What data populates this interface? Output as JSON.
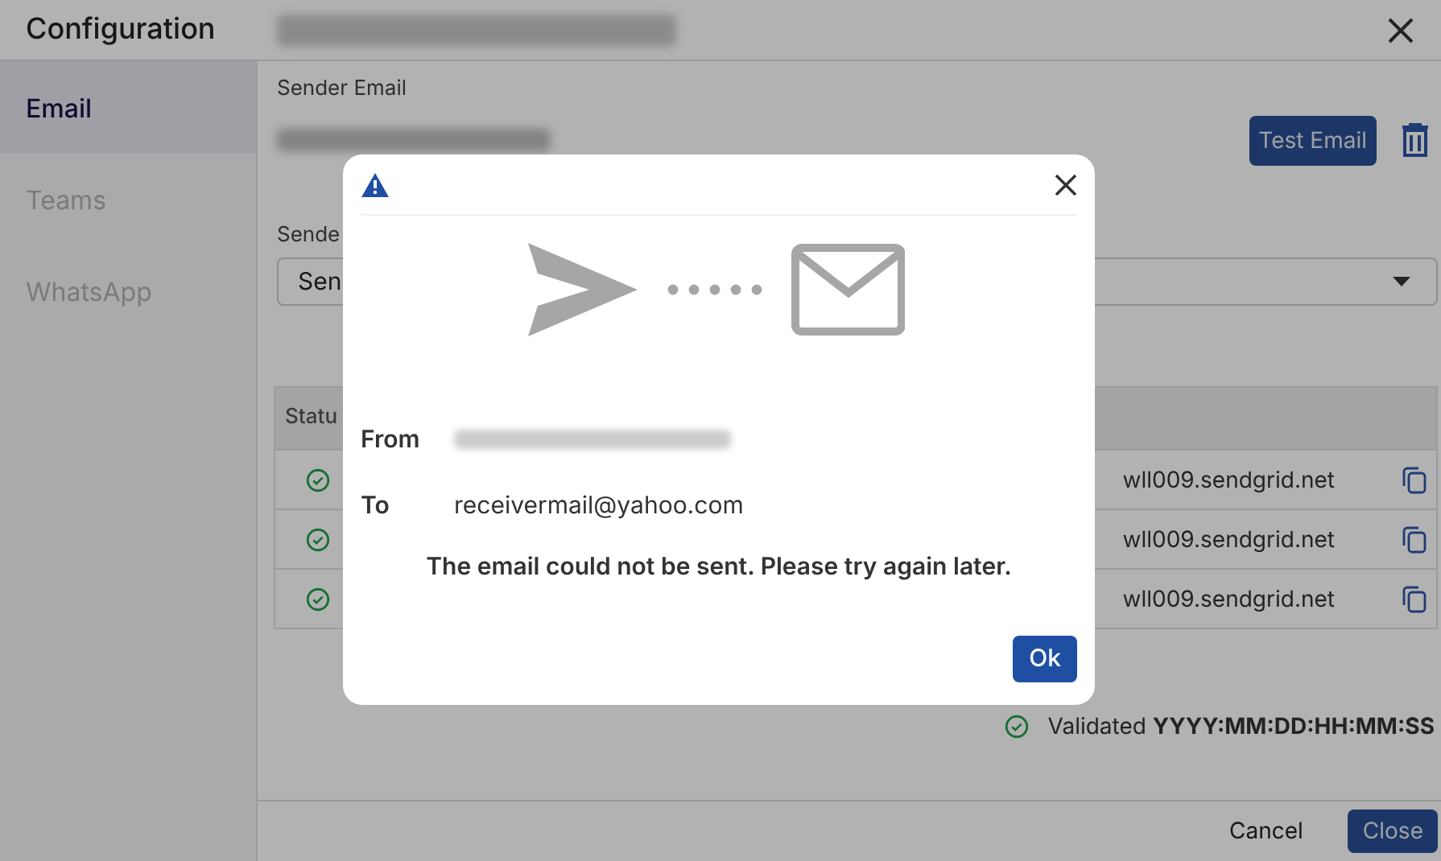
{
  "header": {
    "title": "Configuration"
  },
  "sidebar": {
    "items": [
      {
        "label": "Email",
        "selected": true
      },
      {
        "label": "Teams",
        "selected": false
      },
      {
        "label": "WhatsApp",
        "selected": false
      }
    ]
  },
  "sender_email": {
    "label": "Sender Email"
  },
  "test_email_button": "Test Email",
  "sender_field": {
    "label": "Sende",
    "value": "Sen"
  },
  "table": {
    "columns": [
      "Statu"
    ],
    "rows": [
      {
        "validated": true,
        "column_3": "wll009.sendgrid.net"
      },
      {
        "validated": true,
        "column_3": "wll009.sendgrid.net"
      },
      {
        "validated": true,
        "column_3": "wll009.sendgrid.net"
      }
    ]
  },
  "validation": {
    "validated": true,
    "text": "Validated **YYYY:MM:DD:HH:MM:SS**"
  },
  "footer": {
    "buttons": [
      {
        "label": "Cancel",
        "kind": "text"
      },
      {
        "label": "Close",
        "kind": "primary"
      }
    ]
  },
  "dialog": {
    "from_label": "From",
    "to_label": "To",
    "to_value": "receivermail@yahoo.com",
    "message": "The email could not be sent. Please try again later.",
    "ok_button": "Ok"
  }
}
